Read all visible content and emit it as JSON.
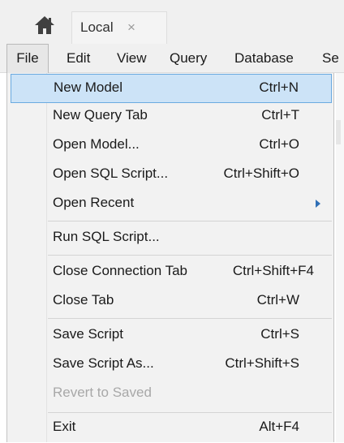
{
  "tabs": {
    "home_icon": "home-icon",
    "active_tab": {
      "label": "Local",
      "close": "×"
    }
  },
  "menubar": {
    "items": [
      {
        "label": "File"
      },
      {
        "label": "Edit"
      },
      {
        "label": "View"
      },
      {
        "label": "Query"
      },
      {
        "label": "Database"
      },
      {
        "label": "Se"
      }
    ]
  },
  "file_menu": {
    "items": [
      {
        "label": "New Model",
        "shortcut": "Ctrl+N"
      },
      {
        "label": "New Query Tab",
        "shortcut": "Ctrl+T"
      },
      {
        "label": "Open Model...",
        "shortcut": "Ctrl+O"
      },
      {
        "label": "Open SQL Script...",
        "shortcut": "Ctrl+Shift+O"
      },
      {
        "label": "Open Recent",
        "shortcut": ""
      },
      {
        "label": "Run SQL Script...",
        "shortcut": ""
      },
      {
        "label": "Close Connection Tab",
        "shortcut": "Ctrl+Shift+F4"
      },
      {
        "label": "Close Tab",
        "shortcut": "Ctrl+W"
      },
      {
        "label": "Save Script",
        "shortcut": "Ctrl+S"
      },
      {
        "label": "Save Script As...",
        "shortcut": "Ctrl+Shift+S"
      },
      {
        "label": "Revert to Saved",
        "shortcut": ""
      },
      {
        "label": "Exit",
        "shortcut": "Alt+F4"
      }
    ]
  },
  "colors": {
    "highlight_bg": "#cce3f7",
    "highlight_border": "#6aaae0",
    "submenu_arrow": "#2f6fb6",
    "disabled_text": "#a8a8a8"
  }
}
